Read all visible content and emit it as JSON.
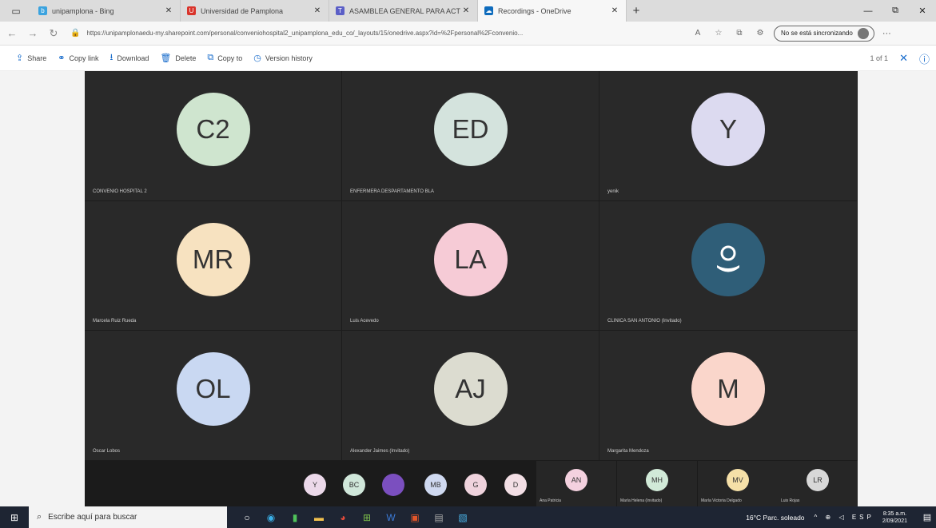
{
  "browser": {
    "tabs": [
      {
        "title": "unipamplona - Bing",
        "fav_color": "#3ba3df",
        "fav_glyph": "b"
      },
      {
        "title": "Universidad de Pamplona",
        "fav_color": "#d9342b",
        "fav_glyph": "U"
      },
      {
        "title": "ASAMBLEA GENERAL PARA ACT",
        "fav_color": "#5b5fc7",
        "fav_glyph": "T"
      },
      {
        "title": "Recordings - OneDrive",
        "fav_color": "#0f6cbd",
        "fav_glyph": "☁",
        "active": true
      }
    ],
    "new_tab": "+",
    "window_controls": [
      "—",
      "⧉",
      "✕"
    ],
    "url": "https://unipamplonaedu-my.sharepoint.com/personal/conveniohospital2_unipamplona_edu_co/_layouts/15/onedrive.aspx?id=%2Fpersonal%2Fconvenio...",
    "sync_label": "No se está sincronizando",
    "more": "···"
  },
  "commandbar": {
    "items": [
      {
        "icon": "share-icon",
        "glyph": "⇪",
        "label": "Share"
      },
      {
        "icon": "link-icon",
        "glyph": "⚭",
        "label": "Copy link"
      },
      {
        "icon": "download-icon",
        "glyph": "⭳",
        "label": "Download"
      },
      {
        "icon": "delete-icon",
        "glyph": "🗑",
        "label": "Delete"
      },
      {
        "icon": "copy-icon",
        "glyph": "⧉",
        "label": "Copy to"
      },
      {
        "icon": "history-icon",
        "glyph": "◷",
        "label": "Version history"
      }
    ],
    "page_count": "1 of 1",
    "close_glyph": "✕",
    "info_glyph": "ⓘ"
  },
  "participants": [
    {
      "initials": "C2",
      "color": "#cfe5cf",
      "name": "CONVENIO HOSPITAL 2"
    },
    {
      "initials": "ED",
      "color": "#d4e3dd",
      "name": "ENFERMERA DESPARTAMENTO BLA"
    },
    {
      "initials": "Y",
      "color": "#dcdaf0",
      "name": "yenik"
    },
    {
      "initials": "MR",
      "color": "#f7e2c0",
      "name": "Marcela Ruiz Rueda"
    },
    {
      "initials": "LA",
      "color": "#f6cbd6",
      "name": "Luis Acevedo"
    },
    {
      "initials": "",
      "color": "#2f5e78",
      "name": "CLINICA SAN ANTONIO (Invitado)"
    },
    {
      "initials": "OL",
      "color": "#c9d8f2",
      "name": "Oscar Lobos"
    },
    {
      "initials": "AJ",
      "color": "#dcdcd0",
      "name": "Alexander Jaimes (Invitado)"
    },
    {
      "initials": "M",
      "color": "#fad6cb",
      "name": "Margarita Mendoza"
    }
  ],
  "overflow_avatars": [
    {
      "initials": "Y",
      "color": "#ecd9ea"
    },
    {
      "initials": "BC",
      "color": "#d0e7da"
    },
    {
      "initials": "",
      "color": "#7b4fbf"
    },
    {
      "initials": "MB",
      "color": "#cfd9f0"
    },
    {
      "initials": "G",
      "color": "#efd3dd"
    },
    {
      "initials": "D",
      "color": "#f3dfe5"
    }
  ],
  "mini_tiles": [
    {
      "initials": "AN",
      "color": "#f4d1df",
      "name": "Ana Patricia"
    },
    {
      "initials": "MH",
      "color": "#d1ead8",
      "name": "María Helena (Invitado)"
    },
    {
      "initials": "MV",
      "color": "#f5e0a8",
      "name": "María Victoria Delgado"
    },
    {
      "initials": "LR",
      "color": "#d8d8d8",
      "name": "Luis Rojas"
    }
  ],
  "taskbar": {
    "search_placeholder": "Escribe aquí para buscar",
    "weather": "16°C Parc. soleado",
    "tray": "^ ⊕ ◁ ESP",
    "time": "8:35 a.m.",
    "date": "2/09/2021"
  }
}
